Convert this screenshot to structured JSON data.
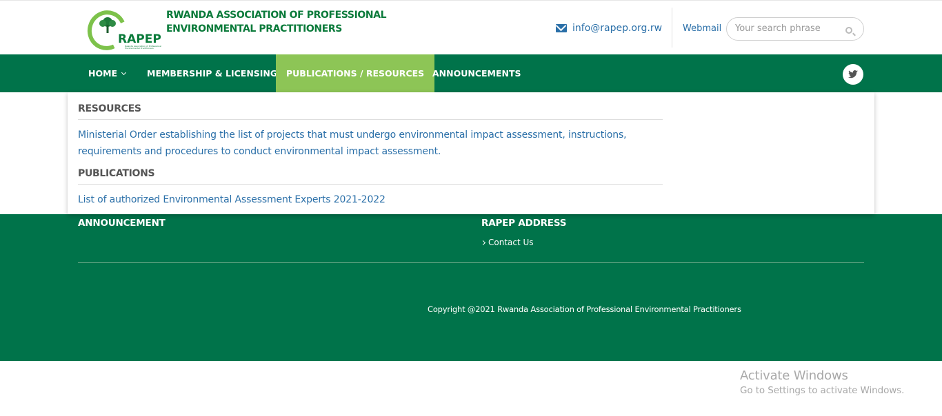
{
  "header": {
    "logo_text": "RAPEP",
    "logo_subtext": "Rwanda Association of Professional Environmental Practitioners",
    "site_title_line1": "RWANDA ASSOCIATION OF PROFESSIONAL",
    "site_title_line2": "ENVIRONMENTAL PRACTITIONERS",
    "email": "info@rapep.org.rw",
    "webmail_label": "Webmail",
    "search_placeholder": "Your search phrase"
  },
  "nav": {
    "items": [
      {
        "label": "HOME"
      },
      {
        "label": "MEMBERSHIP & LICENSING"
      },
      {
        "label": "PUBLICATIONS / RESOURCES"
      },
      {
        "label": "ANNOUNCEMENTS"
      }
    ],
    "active_index": 2
  },
  "dropdown": {
    "resources_heading": "RESOURCES",
    "resources_link": "Ministerial Order establishing the list of projects that must undergo environmental impact assessment, instructions, requirements and procedures to conduct environmental impact assessment.",
    "publications_heading": "PUBLICATIONS",
    "publications_link": "List of authorized Environmental Assessment Experts 2021-2022"
  },
  "footer": {
    "announcement_heading": "ANNOUNCEMENT",
    "address_heading": "RAPEP ADDRESS",
    "contact_link": "Contact Us",
    "copyright": "Copyright @2021 Rwanda Association of Professional Environmental Practitioners"
  },
  "watermark": {
    "line1": "Activate Windows",
    "line2": "Go to Settings to activate Windows."
  },
  "colors": {
    "brand_green": "#00734a",
    "active_green": "#8dc556",
    "link_blue": "#2a6fa8"
  }
}
